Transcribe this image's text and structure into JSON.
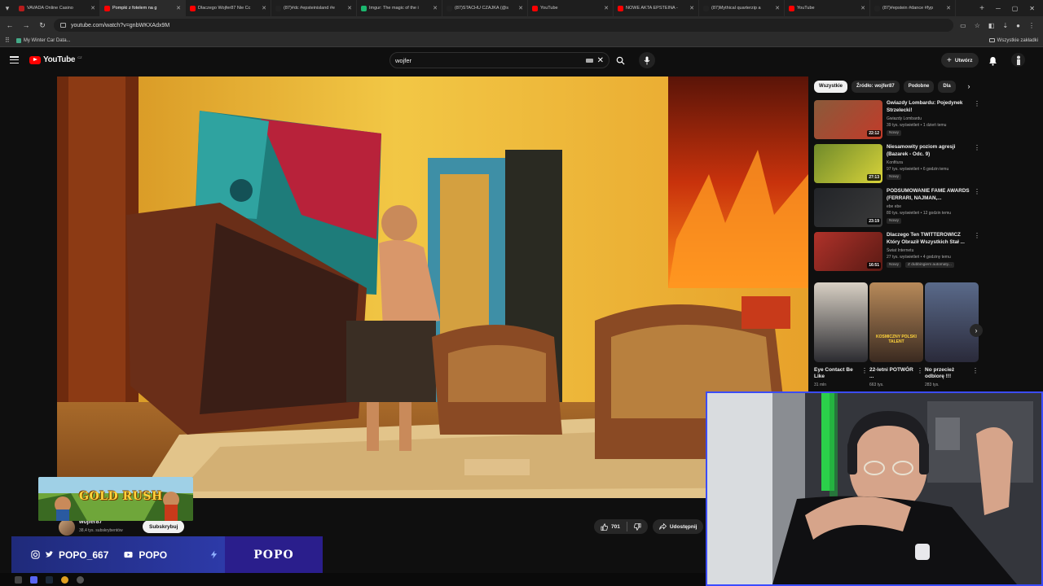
{
  "browser": {
    "tabs": [
      {
        "title": "VAVADA Online Casino",
        "color": "#b71c1c"
      },
      {
        "title": "Pompki z fotelem na g",
        "color": "#ff0000",
        "active": true
      },
      {
        "title": "Dlaczego Wojfer87 Nie Cc",
        "color": "#ff0000"
      },
      {
        "title": "(87)#dc #epsteinisland #e",
        "color": "#222222"
      },
      {
        "title": "Imgur: The magic of the i",
        "color": "#1bb76e"
      },
      {
        "title": "(87)STACHU CZAJKA (@s",
        "color": "#222222"
      },
      {
        "title": "YouTube",
        "color": "#ff0000"
      },
      {
        "title": "NOWE AKTA EPSTEINA -",
        "color": "#ff0000"
      },
      {
        "title": "(87)Mythical quarterzip a",
        "color": "#222222"
      },
      {
        "title": "YouTube",
        "color": "#ff0000"
      },
      {
        "title": "(87)#epstein #dance #fyp",
        "color": "#222222"
      }
    ],
    "url": "youtube.com/watch?v=gnbWKXAdx9M",
    "bookmark": "My Winter Car Data...",
    "all_bookmarks": "Wszystkie zakładki"
  },
  "youtube": {
    "logo_text": "YouTube",
    "logo_country": "CZ",
    "search_value": "wojfer",
    "create_label": "Utwórz"
  },
  "video": {
    "channel": "wojfer87",
    "subscribers": "38,4 tys. subskrybentów",
    "subscribe_label": "Subskrybuj",
    "likes": "701",
    "share_label": "Udostępnij"
  },
  "sidebar": {
    "chips": [
      "Wszystkie",
      "Źródło: wojfer87",
      "Podobne",
      "Dla"
    ],
    "recommendations": [
      {
        "title": "Gwiazdy Lombardu: Pojedynek Strzelecki!",
        "channel": "Gwiazdy Lombardu",
        "meta": "39 tys. wyświetleń • 1 dzień temu",
        "badge": "Nowy",
        "duration": "22:12",
        "thumb_colors": [
          "#8a5a3a",
          "#c23b2a"
        ]
      },
      {
        "title": "Niesamowity poziom agresji (Bazarek - Odc. 9)",
        "channel": "Konfitura",
        "meta": "97 tys. wyświetleń • 6 godzin temu",
        "badge": "Nowy",
        "duration": "27:13",
        "thumb_colors": [
          "#6f8a2a",
          "#d8d33a"
        ]
      },
      {
        "title": "PODSUMOWANIE FAME AWARDS (FERRARI, NAJMAN,...",
        "channel": "ebe ebe",
        "meta": "80 tys. wyświetleń • 12 godzin temu",
        "badge": "Nowy",
        "duration": "23:19",
        "thumb_colors": [
          "#222428",
          "#3a3a3a"
        ]
      },
      {
        "title": "Dlaczego Ten TWITTEROWICZ Który Obraził Wszystkich Stał ...",
        "channel": "Świat Internetu",
        "meta": "27 tys. wyświetleń • 4 godziny temu",
        "badge": "Nowy",
        "badge2": "Z dubbingiem automaty...",
        "duration": "16:51",
        "thumb_colors": [
          "#b0322a",
          "#5a1a14"
        ]
      }
    ],
    "shorts": [
      {
        "title": "Eye Contact Be Like",
        "views": "31 mln",
        "thumb_colors": [
          "#d8d0c4",
          "#2b2b30"
        ]
      },
      {
        "title": "22-letni POTWÓR ...",
        "views": "663 tys.",
        "thumb_colors": [
          "#b88a5a",
          "#3a2a20"
        ],
        "overlay": "KOSMICZNY POLSKI TALENT"
      },
      {
        "title": "No przecież odbiorę !!!",
        "views": "283 tys.",
        "thumb_colors": [
          "#5a6a8a",
          "#2a2a3a"
        ]
      }
    ]
  },
  "overlay": {
    "banner": "GOLD RUSH",
    "social_handle": "POPO_667",
    "youtube_handle": "POPO",
    "brand": "POPO"
  },
  "colors": {
    "youtube_red": "#ff0000",
    "overlay_blue": "#2d3aa8",
    "webcam_border": "#3b4cff"
  }
}
